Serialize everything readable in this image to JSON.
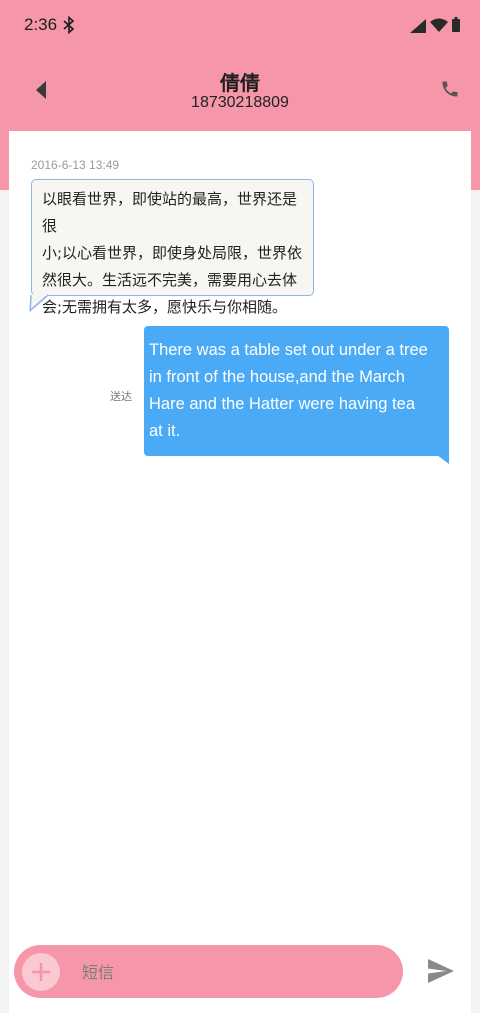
{
  "status_bar": {
    "time": "2:36",
    "icons": [
      "bluetooth-icon",
      "signal-icon",
      "wifi-icon",
      "battery-icon"
    ]
  },
  "header": {
    "contact_name": "倩倩",
    "contact_number": "18730218809",
    "icons": [
      "back-arrow-icon",
      "phone-icon"
    ]
  },
  "colors": {
    "accent_pink": "#f597a9",
    "outgoing_bubble": "#4aaaf5",
    "incoming_bubble_border": "#8fb4e6"
  },
  "conversation": {
    "timestamp": "2016-6-13 13:49",
    "incoming": {
      "lines": [
        "以眼看世界，即使站的最高，世界还是很",
        "小;以心看世界，即使身处局限，世界依",
        "然很大。生活远不完美，需要用心去体",
        "会;无需拥有太多，愿快乐与你相随。"
      ]
    },
    "outgoing": {
      "status": "送达",
      "lines": [
        "There was a table set out under a tree",
        "in front of the house,and the March",
        "Hare and the Hatter were having tea",
        "at it."
      ]
    }
  },
  "composer": {
    "placeholder": "短信",
    "icons": [
      "plus-icon",
      "send-icon"
    ]
  }
}
